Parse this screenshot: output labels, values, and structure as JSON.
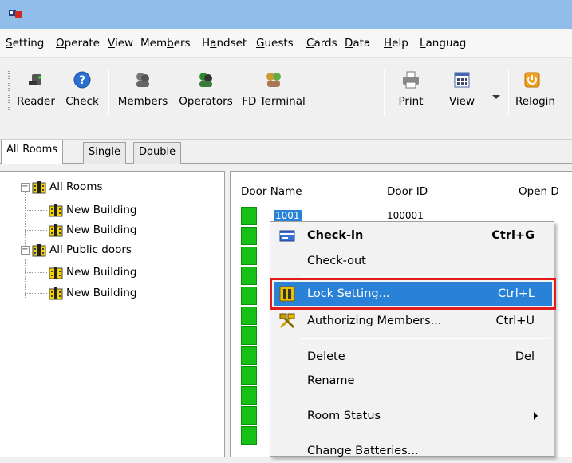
{
  "menubar": {
    "items": [
      {
        "label": "Setting",
        "u": "S",
        "rest": "etting"
      },
      {
        "label": "Operate",
        "u": "O",
        "rest": "perate"
      },
      {
        "label": "View",
        "u": "V",
        "rest": "iew"
      },
      {
        "label": "Members",
        "pre": "Mem",
        "u": "b",
        "rest": "ers"
      },
      {
        "label": "Handset",
        "pre": "H",
        "u": "a",
        "rest": "ndset"
      },
      {
        "label": "Guests",
        "u": "G",
        "rest": "uests"
      },
      {
        "label": "Cards",
        "u": "C",
        "rest": "ards"
      },
      {
        "label": "Data",
        "u": "D",
        "rest": "ata"
      },
      {
        "label": "Help",
        "u": "H",
        "rest": "elp"
      },
      {
        "label": "Languag",
        "u": "L",
        "rest": "anguag"
      }
    ]
  },
  "toolbar": {
    "reader": "Reader",
    "check": "Check",
    "members": "Members",
    "operators": "Operators",
    "fd_terminal": "FD Terminal",
    "print": "Print",
    "view": "View",
    "relogin": "Relogin"
  },
  "tabs": [
    "All Rooms",
    "Single",
    "Double"
  ],
  "tree": {
    "root1": "All Rooms",
    "child1": "New Building",
    "child2": "New Building",
    "root2": "All Public doors",
    "child3": "New Building",
    "child4": "New Building"
  },
  "list": {
    "col_door_name": "Door Name",
    "col_door_id": "Door ID",
    "col_open": "Open D",
    "row1_name": "1001",
    "row1_id": "100001"
  },
  "context_menu": {
    "checkin": "Check-in",
    "checkin_sc": "Ctrl+G",
    "checkout": "Check-out",
    "lock_setting": "Lock Setting...",
    "lock_setting_sc": "Ctrl+L",
    "authorizing": "Authorizing Members...",
    "authorizing_sc": "Ctrl+U",
    "delete": "Delete",
    "delete_sc": "Del",
    "rename": "Rename",
    "room_status": "Room Status",
    "change_batteries": "Change Batteries..."
  },
  "colors": {
    "titlebar": "#90bde9",
    "highlight": "#2a82d8",
    "highlight_border": "#e21b1b",
    "status_green": "#16c016"
  }
}
